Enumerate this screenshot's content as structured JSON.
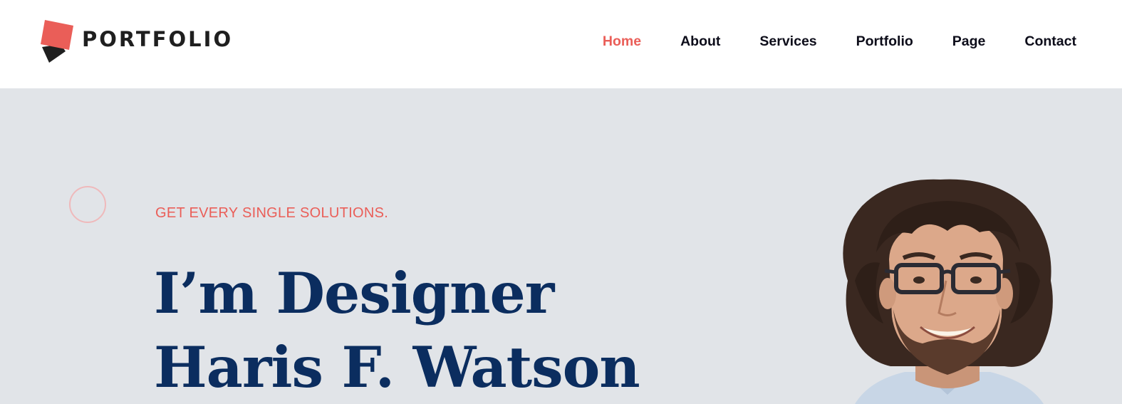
{
  "brand": {
    "logo_text": "PORTFOLIO",
    "icon": "stacked-squares-logo-icon",
    "accent_color": "#ea5e58",
    "dark_color": "#1f1f1f"
  },
  "nav": {
    "items": [
      {
        "label": "Home",
        "active": true
      },
      {
        "label": "About",
        "active": false
      },
      {
        "label": "Services",
        "active": false
      },
      {
        "label": "Portfolio",
        "active": false
      },
      {
        "label": "Page",
        "active": false
      },
      {
        "label": "Contact",
        "active": false
      }
    ],
    "active_color": "#ea5e58",
    "text_color": "#0d0d1a"
  },
  "hero": {
    "tagline": "GET EVERY SINGLE SOLUTIONS.",
    "headline_line1": "I’m Designer",
    "headline_line2": "Haris F. Watson",
    "background_color": "#e1e4e8",
    "headline_color": "#0b2d5f",
    "decoration": "outline-circle-icon",
    "image": "portrait-of-smiling-man-with-glasses"
  }
}
